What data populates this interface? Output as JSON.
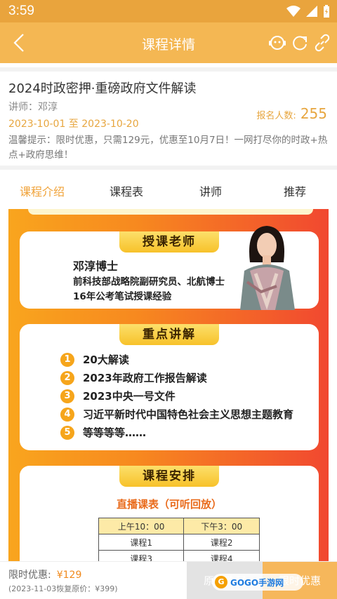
{
  "status_bar": {
    "time": "3:59"
  },
  "app_bar": {
    "title": "课程详情"
  },
  "course": {
    "title": "2024时政密押·重磅政府文件解读",
    "teacher": "讲师：邓淳",
    "dates": "2023-10-01 至 2023-10-20",
    "enroll_label": "报名人数:",
    "enroll_count": "255",
    "notice": "温馨提示：限时优惠，只需129元，优惠至10月7日！一网打尽你的时政+热点+政府思维！"
  },
  "tabs": [
    "课程介绍",
    "课程表",
    "讲师",
    "推荐"
  ],
  "poster": {
    "teacher_section": {
      "label": "授课老师",
      "name": "邓淳博士",
      "lines": [
        "前科技部战略院副研究员、北航博士",
        "16年公考笔试授课经验"
      ]
    },
    "focus_section": {
      "label": "重点讲解",
      "items": [
        {
          "num": "1",
          "text": "20大解读"
        },
        {
          "num": "2",
          "text": "2023年政府工作报告解读"
        },
        {
          "num": "3",
          "text": "2023中央一号文件"
        },
        {
          "num": "4",
          "text": "习近平新时代中国特色社会主义思想主题教育"
        },
        {
          "num": "5",
          "text": "等等等等……"
        }
      ]
    },
    "schedule_section": {
      "label": "课程安排",
      "subtitle": "直播课表（可听回放）",
      "headers": [
        "上午10：00",
        "下午3：00"
      ],
      "rows": [
        [
          "课程1",
          "课程2"
        ],
        [
          "课程3",
          "课程4"
        ]
      ]
    }
  },
  "bottom_bar": {
    "limited_label": "限时优惠:",
    "price": "¥129",
    "restore_note": "(2023-11-03恢复原价：¥399)",
    "original_button": "原价购买",
    "limited_button": "限时优惠"
  },
  "watermark": "GOGO手游网",
  "colors": {
    "accent": "#f4b753",
    "status_bar": "#e9a43d",
    "highlight": "#f0a238"
  }
}
